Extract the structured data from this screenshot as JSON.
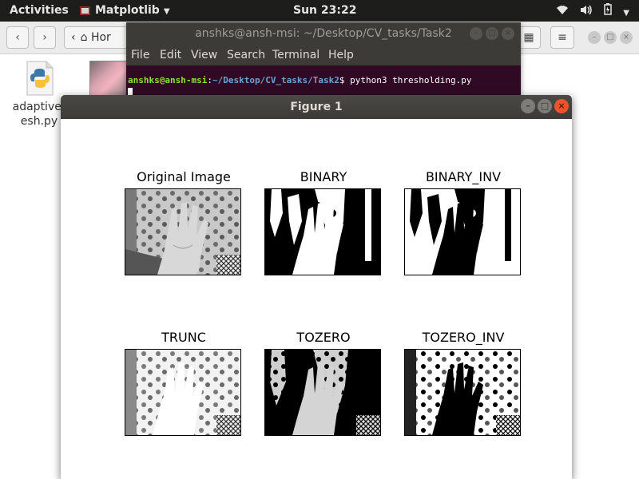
{
  "topbar": {
    "activities": "Activities",
    "app_name": "Matplotlib",
    "clock": "Sun 23:22",
    "tray_icons": [
      "wifi-icon",
      "volume-icon",
      "battery-icon",
      "system-menu-caret-icon"
    ]
  },
  "files": {
    "path_label": "Hor",
    "file_name_line1": "adaptivet",
    "file_name_line2": "esh.py"
  },
  "terminal": {
    "title": "anshks@ansh-msi: ~/Desktop/CV_tasks/Task2",
    "menu": [
      "File",
      "Edit",
      "View",
      "Search",
      "Terminal",
      "Help"
    ],
    "prompt_user": "anshks@ansh-msi",
    "prompt_sep": ":",
    "prompt_path": "~/Desktop/CV_tasks/Task2",
    "prompt_end": "$",
    "command": " python3 thresholding.py"
  },
  "figure": {
    "title": "Figure 1",
    "subplots": [
      {
        "title": "Original Image"
      },
      {
        "title": "BINARY"
      },
      {
        "title": "BINARY_INV"
      },
      {
        "title": "TRUNC"
      },
      {
        "title": "TOZERO"
      },
      {
        "title": "TOZERO_INV"
      }
    ]
  },
  "colors": {
    "panel_bg": "#1d1d1b",
    "terminal_bg": "#300a24",
    "title_bar": "#3c3b37",
    "close_button": "#e9542c",
    "prompt_user": "#8ae234",
    "prompt_path": "#729fcf"
  }
}
